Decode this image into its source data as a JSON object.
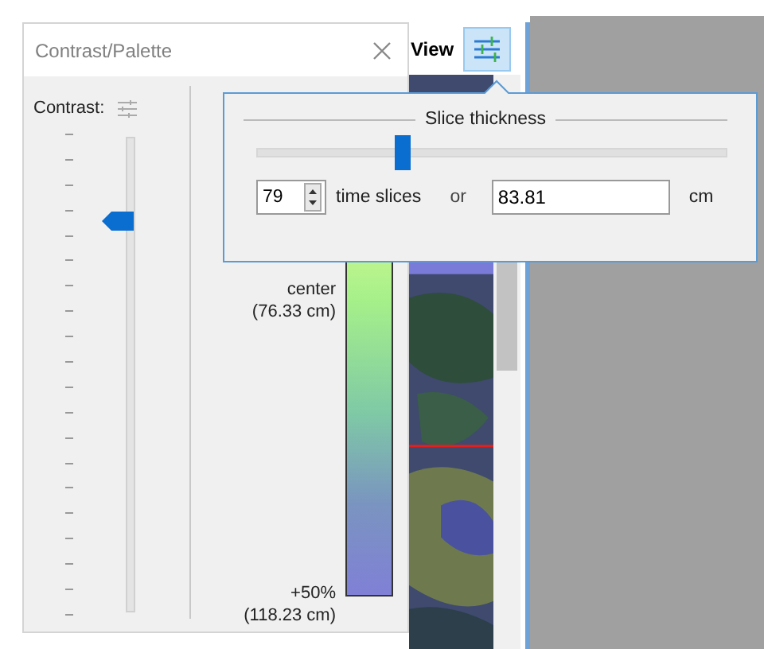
{
  "contrast_palette": {
    "title": "Contrast/Palette",
    "contrast_label": "Contrast:",
    "contrast_slider": {
      "level": 0.81
    },
    "color_bar": {
      "labels": [
        {
          "text": "center",
          "value": "(76.33 cm)"
        },
        {
          "text": "+50%",
          "value": "(118.23 cm)"
        }
      ]
    }
  },
  "view": {
    "label": "View"
  },
  "slice_popup": {
    "title": "Slice thickness",
    "slider": {
      "level": 0.31
    },
    "time_slices": {
      "value": "79",
      "label": "time slices"
    },
    "separator": "or",
    "thickness": {
      "value": "83.81",
      "unit": "cm"
    }
  }
}
